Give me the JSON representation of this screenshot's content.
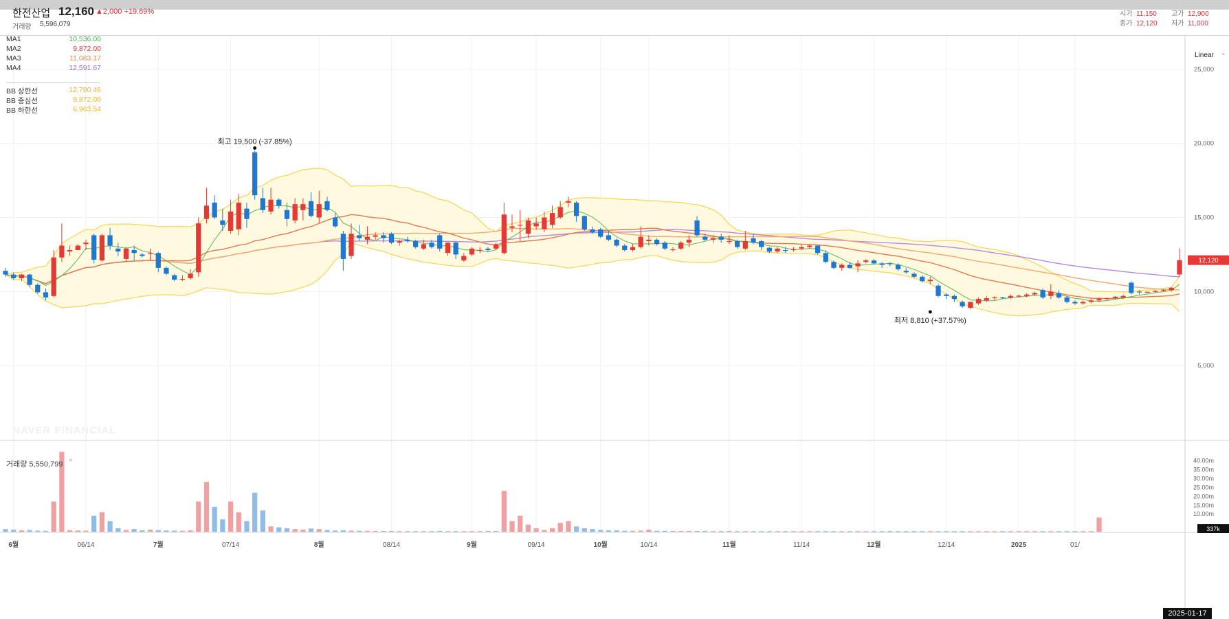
{
  "header": {
    "stock_name": "한전산업",
    "price": "12,160",
    "change": "▲2,000 +19.69%",
    "volume_label": "거래량",
    "volume_value": "5,596,079",
    "ohlc": {
      "open_label": "시가",
      "open": "11,150",
      "high_label": "고가",
      "high": "12,900",
      "close_label": "종가",
      "close": "12,120",
      "low_label": "저가",
      "low": "11,000"
    }
  },
  "legend": [
    {
      "label": "MA1",
      "value": "10,536.00",
      "color": "#4caf50"
    },
    {
      "label": "MA2",
      "value": "9,872.00",
      "color": "#e53935"
    },
    {
      "label": "MA3",
      "value": "11,083.17",
      "color": "#ef8a4b"
    },
    {
      "label": "MA4",
      "value": "12,591.67",
      "color": "#9c6ad1"
    },
    {
      "label": "BB 상한선",
      "value": "12,780.46",
      "color": "#f0b429"
    },
    {
      "label": "BB 중심선",
      "value": "9,872.00",
      "color": "#f0b429"
    },
    {
      "label": "BB 하한선",
      "value": "6,963.54",
      "color": "#f0b429"
    }
  ],
  "scale_mode": "Linear",
  "volume_panel": {
    "title": "거래량 5,550,799",
    "close_icon": "close-icon",
    "close_glyph": "×"
  },
  "watermark": "NAVER FINANCIAL",
  "date_badge": "2025-01-17",
  "chart_data": {
    "type": "candlestick",
    "price_axis": {
      "ticks": [
        5000,
        10000,
        15000,
        20000,
        25000
      ],
      "tick_labels": [
        "5,000",
        "10,000",
        "15,000",
        "20,000",
        "25,000"
      ],
      "ylim": [
        0,
        27500
      ]
    },
    "volume_axis": {
      "ticks": [
        10,
        15,
        20,
        25,
        30,
        35,
        40
      ],
      "tick_labels": [
        "10.00m",
        "15.00m",
        "20.00m",
        "25.00m",
        "30.00m",
        "35.00m",
        "40.00m"
      ],
      "ylim": [
        0,
        48
      ]
    },
    "x_labels": [
      "6월",
      "06/14",
      "7월",
      "07/14",
      "8월",
      "08/14",
      "9월",
      "09/14",
      "10월",
      "10/14",
      "11월",
      "11/14",
      "12월",
      "12/14",
      "2025",
      "01/"
    ],
    "x_label_index": [
      1,
      10,
      19,
      28,
      39,
      48,
      58,
      66,
      74,
      80,
      90,
      99,
      108,
      117,
      126,
      133
    ],
    "current_price_label": "12,120",
    "current_volume_label": "337k",
    "annotations": [
      {
        "text": "최고 19,500 (-37.85%)",
        "index": 31,
        "value": 19500,
        "position": "above"
      },
      {
        "text": "최저 8,810 (+37.57%)",
        "index": 115,
        "value": 8810,
        "position": "below"
      }
    ],
    "candles": [
      [
        11400,
        11600,
        11000,
        11150
      ],
      [
        11150,
        11300,
        10800,
        10900
      ],
      [
        10900,
        11200,
        10700,
        11150
      ],
      [
        11150,
        11200,
        10300,
        10450
      ],
      [
        10450,
        10550,
        9850,
        9950
      ],
      [
        9950,
        10200,
        9400,
        9600
      ],
      [
        9700,
        12800,
        9600,
        12300
      ],
      [
        12300,
        14600,
        12000,
        13100
      ],
      [
        12700,
        13100,
        12400,
        12800
      ],
      [
        12800,
        13200,
        12800,
        13100
      ],
      [
        13200,
        13500,
        12800,
        13300
      ],
      [
        13800,
        13900,
        11900,
        12150
      ],
      [
        12100,
        13900,
        12000,
        13800
      ],
      [
        13800,
        14300,
        12800,
        13100
      ],
      [
        12900,
        13300,
        12400,
        12700
      ],
      [
        12200,
        13000,
        12000,
        12900
      ],
      [
        12800,
        13100,
        12100,
        12600
      ],
      [
        12500,
        12600,
        12300,
        12400
      ],
      [
        12600,
        12900,
        12100,
        12600
      ],
      [
        12600,
        12700,
        11300,
        11600
      ],
      [
        11600,
        11700,
        11100,
        11200
      ],
      [
        11100,
        11200,
        10700,
        10800
      ],
      [
        10800,
        11100,
        10700,
        10850
      ],
      [
        10900,
        11500,
        10800,
        11200
      ],
      [
        11300,
        15000,
        11000,
        14600
      ],
      [
        14900,
        17000,
        14600,
        15800
      ],
      [
        16000,
        16500,
        14900,
        15000
      ],
      [
        14800,
        15600,
        14100,
        14500
      ],
      [
        14100,
        16200,
        13900,
        15400
      ],
      [
        14200,
        16600,
        13800,
        16000
      ],
      [
        15600,
        16000,
        14300,
        14900
      ],
      [
        19400,
        19500,
        16200,
        16500
      ],
      [
        16300,
        17000,
        15300,
        15500
      ],
      [
        15400,
        17000,
        15200,
        16200
      ],
      [
        16200,
        16300,
        15600,
        15800
      ],
      [
        15500,
        16000,
        14400,
        14900
      ],
      [
        14800,
        16300,
        14600,
        15900
      ],
      [
        15500,
        16300,
        14800,
        15900
      ],
      [
        16100,
        16700,
        15000,
        15100
      ],
      [
        15000,
        16800,
        14600,
        15900
      ],
      [
        16100,
        16400,
        15400,
        15500
      ],
      [
        15000,
        15300,
        14300,
        14400
      ],
      [
        13900,
        14100,
        11400,
        12200
      ],
      [
        12400,
        14600,
        12200,
        13900
      ],
      [
        13800,
        14500,
        13400,
        13600
      ],
      [
        13500,
        14400,
        13200,
        13700
      ],
      [
        13700,
        14000,
        13500,
        13800
      ],
      [
        13800,
        14000,
        13300,
        13600
      ],
      [
        13900,
        14000,
        13200,
        13300
      ],
      [
        13300,
        13500,
        13100,
        13400
      ],
      [
        13500,
        13700,
        13300,
        13400
      ],
      [
        13400,
        13500,
        12900,
        13000
      ],
      [
        12900,
        13500,
        12800,
        13200
      ],
      [
        13300,
        13500,
        12900,
        13000
      ],
      [
        13800,
        13900,
        12700,
        12900
      ],
      [
        12600,
        13300,
        12400,
        13300
      ],
      [
        13300,
        13400,
        12200,
        12500
      ],
      [
        12100,
        12600,
        12000,
        12400
      ],
      [
        12500,
        13000,
        12400,
        12900
      ],
      [
        12800,
        13000,
        12600,
        12800
      ],
      [
        12900,
        13000,
        12700,
        12800
      ],
      [
        12900,
        13300,
        12800,
        13200
      ],
      [
        12600,
        16000,
        12500,
        15200
      ],
      [
        14300,
        15200,
        14000,
        14400
      ],
      [
        14500,
        15500,
        13400,
        14500
      ],
      [
        13900,
        15000,
        13600,
        14800
      ],
      [
        14400,
        15000,
        14200,
        14600
      ],
      [
        14200,
        15400,
        14000,
        15000
      ],
      [
        14500,
        15800,
        14300,
        15300
      ],
      [
        15000,
        16100,
        14900,
        15700
      ],
      [
        16000,
        16400,
        15700,
        16100
      ],
      [
        16000,
        16100,
        14700,
        15100
      ],
      [
        15100,
        15100,
        14100,
        14200
      ],
      [
        14200,
        14400,
        13900,
        14000
      ],
      [
        14200,
        14300,
        13600,
        13700
      ],
      [
        13800,
        14100,
        13400,
        13500
      ],
      [
        13500,
        13600,
        13000,
        13100
      ],
      [
        13100,
        13200,
        12700,
        12800
      ],
      [
        12800,
        13200,
        12700,
        13000
      ],
      [
        13000,
        14400,
        12900,
        13700
      ],
      [
        13400,
        13800,
        13100,
        13500
      ],
      [
        13500,
        13600,
        13100,
        13200
      ],
      [
        13300,
        13400,
        12800,
        12900
      ],
      [
        12800,
        13000,
        12700,
        12850
      ],
      [
        12900,
        13400,
        12800,
        13300
      ],
      [
        13300,
        13800,
        13000,
        13500
      ],
      [
        14800,
        15100,
        13700,
        13800
      ],
      [
        13700,
        13900,
        13400,
        13500
      ],
      [
        13500,
        13800,
        13300,
        13600
      ],
      [
        13700,
        13900,
        13300,
        13500
      ],
      [
        13400,
        13800,
        13200,
        13400
      ],
      [
        13400,
        13500,
        12900,
        13000
      ],
      [
        12900,
        14100,
        12800,
        13400
      ],
      [
        13600,
        13900,
        13200,
        13300
      ],
      [
        13400,
        13500,
        12800,
        13000
      ],
      [
        12950,
        13000,
        12600,
        12700
      ],
      [
        12700,
        13000,
        12600,
        12900
      ],
      [
        12800,
        13000,
        12600,
        12750
      ],
      [
        12800,
        13000,
        12700,
        12850
      ],
      [
        12900,
        13200,
        12800,
        13000
      ],
      [
        13000,
        13200,
        12900,
        13100
      ],
      [
        13100,
        13100,
        12500,
        12600
      ],
      [
        12600,
        12800,
        11900,
        12000
      ],
      [
        12000,
        12100,
        11500,
        11600
      ],
      [
        11600,
        11900,
        11400,
        11800
      ],
      [
        11800,
        12000,
        11500,
        11600
      ],
      [
        11700,
        12100,
        11300,
        11900
      ],
      [
        12000,
        12200,
        11900,
        12100
      ],
      [
        12100,
        12200,
        11800,
        11900
      ],
      [
        11900,
        12000,
        11600,
        11800
      ],
      [
        11900,
        12000,
        11700,
        11850
      ],
      [
        11800,
        11900,
        11400,
        11500
      ],
      [
        11400,
        11600,
        11200,
        11300
      ],
      [
        11200,
        11300,
        10900,
        11000
      ],
      [
        11000,
        11100,
        10600,
        10700
      ],
      [
        10700,
        11000,
        10500,
        10800
      ],
      [
        10400,
        10500,
        9600,
        9700
      ],
      [
        9800,
        9900,
        9500,
        9700
      ],
      [
        9700,
        9800,
        9300,
        9500
      ],
      [
        9300,
        9400,
        8900,
        9000
      ],
      [
        8900,
        9200,
        8810,
        9300
      ],
      [
        9200,
        9600,
        9100,
        9500
      ],
      [
        9400,
        9700,
        9300,
        9550
      ],
      [
        9550,
        9700,
        9400,
        9600
      ],
      [
        9600,
        9650,
        9500,
        9580
      ],
      [
        9580,
        9800,
        9500,
        9700
      ],
      [
        9700,
        9800,
        9600,
        9720
      ],
      [
        9700,
        9900,
        9600,
        9800
      ],
      [
        9800,
        10000,
        9700,
        9900
      ],
      [
        10100,
        10200,
        9500,
        9600
      ],
      [
        9700,
        10500,
        9500,
        10000
      ],
      [
        9900,
        10100,
        9500,
        9600
      ],
      [
        9600,
        9700,
        9200,
        9300
      ],
      [
        9300,
        9400,
        9100,
        9200
      ],
      [
        9200,
        9400,
        9100,
        9300
      ],
      [
        9300,
        9500,
        9200,
        9400
      ],
      [
        9400,
        9600,
        9300,
        9500
      ],
      [
        9500,
        9600,
        9400,
        9550
      ],
      [
        9550,
        9700,
        9500,
        9650
      ],
      [
        9600,
        9800,
        9500,
        9700
      ],
      [
        10600,
        10700,
        9800,
        9900
      ],
      [
        10000,
        10100,
        9800,
        9950
      ],
      [
        9950,
        10000,
        9900,
        9980
      ],
      [
        9980,
        10100,
        9900,
        10050
      ],
      [
        10050,
        10150,
        10000,
        10100
      ],
      [
        10100,
        10300,
        10000,
        10250
      ],
      [
        11150,
        12900,
        11000,
        12120
      ]
    ],
    "volumes": [
      1.5,
      1.2,
      0.8,
      1.0,
      0.6,
      0.5,
      17,
      45,
      0.9,
      0.7,
      0.6,
      9,
      11,
      6,
      2,
      1,
      1.5,
      0.8,
      1.2,
      0.9,
      0.7,
      0.6,
      0.5,
      0.8,
      17,
      28,
      14,
      7,
      17,
      11,
      6,
      22,
      12,
      3,
      2.5,
      2,
      1.5,
      1.2,
      1.8,
      1.5,
      1,
      0.7,
      0.8,
      0.6,
      0.5,
      0.5,
      0.4,
      0.4,
      0.4,
      0.3,
      0.3,
      0.3,
      0.3,
      0.3,
      0.4,
      0.3,
      0.3,
      0.3,
      0.3,
      0.3,
      0.4,
      0.4,
      23,
      6,
      9,
      4,
      2,
      1,
      2,
      5,
      6,
      3,
      2,
      1.5,
      1,
      0.8,
      0.8,
      0.5,
      0.5,
      0.6,
      1.2,
      0.5,
      0.5,
      0.4,
      0.4,
      0.4,
      0.4,
      0.4,
      0.3,
      0.3,
      0.4,
      0.3,
      0.3,
      0.3,
      0.3,
      0.3,
      0.3,
      0.3,
      0.3,
      0.3,
      0.3,
      0.3,
      0.3,
      0.3,
      0.3,
      0.3,
      0.3,
      0.3,
      0.3,
      0.3,
      0.3,
      0.3,
      0.3,
      0.3,
      0.3,
      0.3,
      0.3,
      0.3,
      0.3,
      0.3,
      0.3,
      0.3,
      0.3,
      0.3,
      0.3,
      0.3,
      0.3,
      0.3,
      0.3,
      0.3,
      0.3,
      0.3,
      0.3,
      0.3,
      0.3,
      0.3,
      8
    ]
  }
}
